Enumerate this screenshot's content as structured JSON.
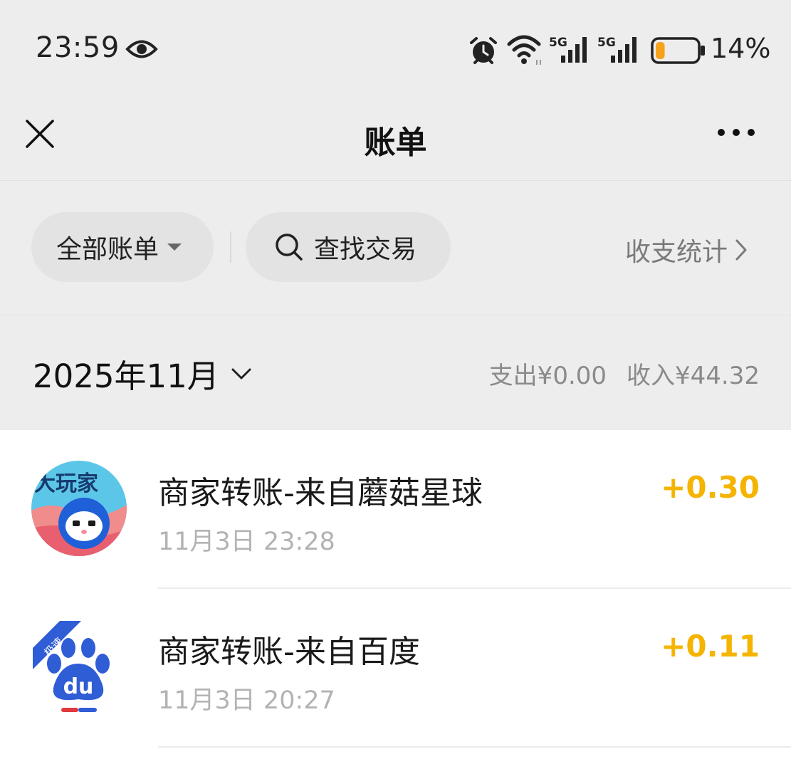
{
  "status_bar": {
    "time": "23:59",
    "battery_percent": "14%",
    "battery_level": 0.14,
    "signal_labels": [
      "5G",
      "5G"
    ]
  },
  "header": {
    "title": "账单"
  },
  "filters": {
    "all_bills_label": "全部账单",
    "search_label": "查找交易",
    "stats_label": "收支统计"
  },
  "month": {
    "label": "2025年11月",
    "expense": "支出¥0.00",
    "income": "收入¥44.32"
  },
  "transactions": [
    {
      "title": "商家转账-来自蘑菇星球",
      "time": "11月3日 23:28",
      "amount": "+0.30",
      "avatar_text": "大玩家",
      "icon": "mushroom-planet-logo"
    },
    {
      "title": "商家转账-来自百度",
      "time": "11月3日 20:27",
      "amount": "+0.11",
      "avatar_text": "du",
      "badge_text": "极速",
      "icon": "baidu-logo"
    }
  ],
  "colors": {
    "income_amount": "#f4b400",
    "page_bg": "#ededed",
    "list_bg": "#ffffff",
    "battery_low": "#f7a21b",
    "baidu_blue": "#2f5dd6"
  }
}
